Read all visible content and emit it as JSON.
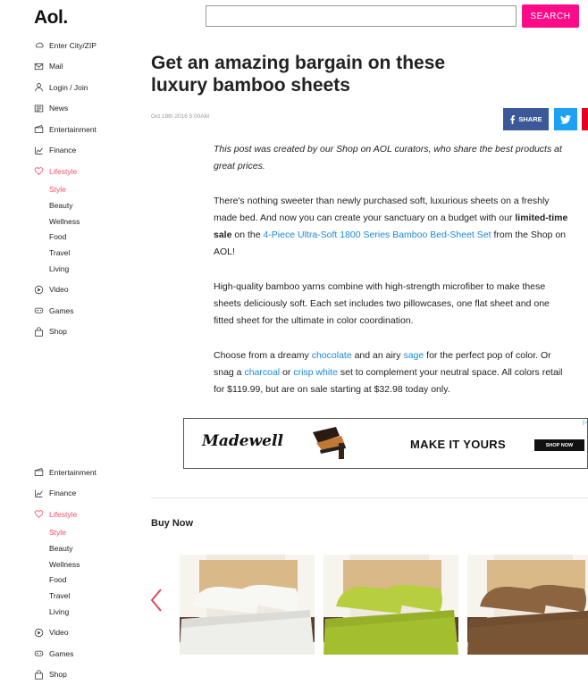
{
  "header": {
    "logo": "Aol.",
    "search_button": "SEARCH",
    "search_value": ""
  },
  "sidebar_top": [
    {
      "label": "Enter City/ZIP",
      "icon": "weather-icon"
    },
    {
      "label": "Mail",
      "icon": "mail-icon"
    },
    {
      "label": "Login / Join",
      "icon": "user-icon"
    },
    {
      "label": "News",
      "icon": "news-icon"
    },
    {
      "label": "Entertainment",
      "icon": "clapper-icon"
    },
    {
      "label": "Finance",
      "icon": "chart-icon"
    },
    {
      "label": "Lifestyle",
      "icon": "heart-icon",
      "active": true
    }
  ],
  "sidebar_top_sub": [
    {
      "label": "Style",
      "active": true
    },
    {
      "label": "Beauty"
    },
    {
      "label": "Wellness"
    },
    {
      "label": "Food"
    },
    {
      "label": "Travel"
    },
    {
      "label": "Living"
    }
  ],
  "sidebar_top_after": [
    {
      "label": "Video",
      "icon": "play-icon"
    },
    {
      "label": "Games",
      "icon": "gamepad-icon"
    },
    {
      "label": "Shop",
      "icon": "bag-icon"
    }
  ],
  "sidebar_bottom": [
    {
      "label": "Entertainment",
      "icon": "clapper-icon"
    },
    {
      "label": "Finance",
      "icon": "chart-icon"
    },
    {
      "label": "Lifestyle",
      "icon": "heart-icon",
      "active": true
    }
  ],
  "sidebar_bottom_sub": [
    {
      "label": "Style",
      "active": true
    },
    {
      "label": "Beauty"
    },
    {
      "label": "Wellness"
    },
    {
      "label": "Food"
    },
    {
      "label": "Travel"
    },
    {
      "label": "Living"
    }
  ],
  "sidebar_bottom_after": [
    {
      "label": "Video",
      "icon": "play-icon"
    },
    {
      "label": "Games",
      "icon": "gamepad-icon"
    },
    {
      "label": "Shop",
      "icon": "bag-icon"
    }
  ],
  "article": {
    "title": "Get an amazing bargain on these luxury bamboo sheets",
    "date": "Oct 18th 2016 5:00AM",
    "share_label": "SHARE",
    "intro": "This post was created by our Shop on AOL curators, who share the best products at great prices.",
    "p1_a": "There's nothing sweeter than newly purchased soft, luxurious sheets on a freshly made bed. And now you can create your sanctuary on a budget with our ",
    "p1_bold": "limited-time sale",
    "p1_b": " on the ",
    "p1_link": "4-Piece Ultra-Soft 1800 Series Bamboo Bed-Sheet Set",
    "p1_c": " from the Shop on AOL!",
    "p2": "High-quality bamboo yarns combine with high-strength microfiber to make these sheets deliciously soft. Each set includes two pillowcases, one flat sheet and one fitted sheet for the ultimate in color coordination.",
    "p3_a": "Choose from a dreamy ",
    "p3_link1": "chocolate",
    "p3_b": " and an airy ",
    "p3_link2": "sage",
    "p3_c": " for the perfect pop of color. Or snag a ",
    "p3_link3": "charcoal",
    "p3_d": " or ",
    "p3_link4": "crisp white",
    "p3_e": " set to complement your neutral space. All colors retail for $119.99, but are on sale starting at $32.98 today only."
  },
  "ad": {
    "brand": "Madewell",
    "cta": "MAKE IT YOURS",
    "shop": "SHOP NOW"
  },
  "buy_now": "Buy Now",
  "products": [
    {
      "sheet_color": "#eeeeea",
      "pillow_color": "#f7f7f4"
    },
    {
      "sheet_color": "#a4bf2e",
      "pillow_color": "#b7cf3f"
    },
    {
      "sheet_color": "#7a5534",
      "pillow_color": "#8c643f"
    }
  ],
  "colors": {
    "accent_pink": "#ff0b8a",
    "lifestyle": "#ff4d6a",
    "link": "#1a8ad9",
    "facebook": "#3b5998",
    "twitter": "#1da1f2"
  }
}
